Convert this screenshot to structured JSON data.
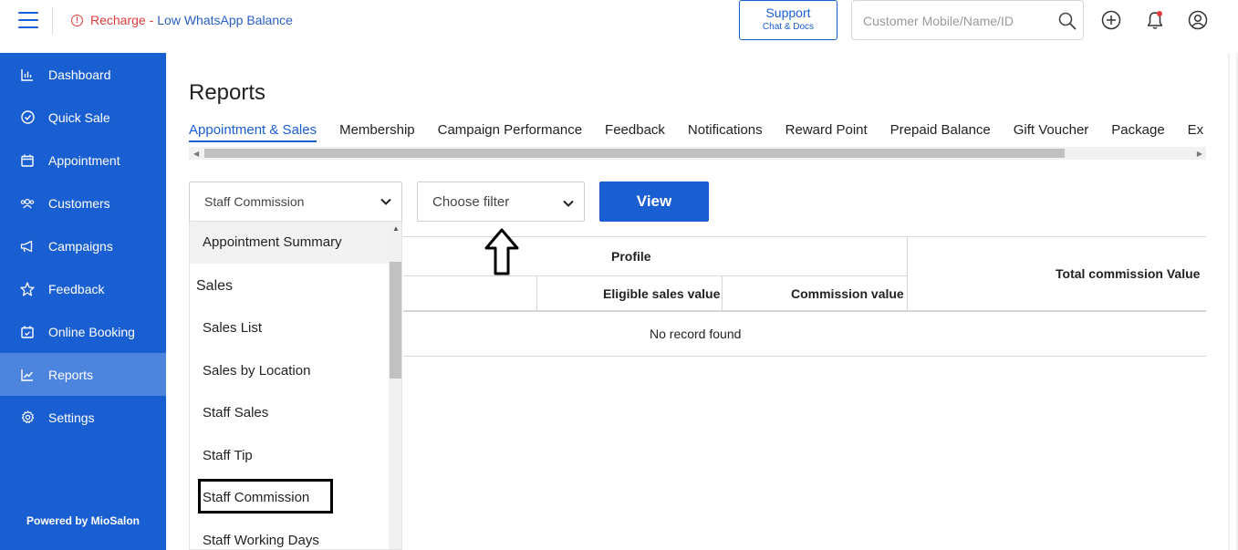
{
  "topbar": {
    "alert_prefix": "Recharge -",
    "alert_text": "Low WhatsApp Balance",
    "support_label": "Support",
    "support_sublabel": "Chat & Docs",
    "search_placeholder": "Customer Mobile/Name/ID"
  },
  "sidebar": {
    "items": [
      {
        "label": "Dashboard",
        "icon": "bar-chart-icon"
      },
      {
        "label": "Quick Sale",
        "icon": "check-circle-icon"
      },
      {
        "label": "Appointment",
        "icon": "calendar-icon"
      },
      {
        "label": "Customers",
        "icon": "users-icon"
      },
      {
        "label": "Campaigns",
        "icon": "megaphone-icon"
      },
      {
        "label": "Feedback",
        "icon": "star-icon"
      },
      {
        "label": "Online Booking",
        "icon": "calendar-check-icon"
      },
      {
        "label": "Reports",
        "icon": "line-chart-icon",
        "active": true
      },
      {
        "label": "Settings",
        "icon": "gear-icon"
      }
    ],
    "powered_by": "Powered by MioSalon"
  },
  "main": {
    "title": "Reports",
    "tabs": [
      "Appointment & Sales",
      "Membership",
      "Campaign Performance",
      "Feedback",
      "Notifications",
      "Reward Point",
      "Prepaid Balance",
      "Gift Voucher",
      "Package",
      "Ex"
    ],
    "active_tab": "Appointment & Sales",
    "report_select_value": "Staff Commission",
    "filter_select_value": "Choose filter",
    "view_label": "View",
    "table": {
      "profile_header": "Profile",
      "eligible_header": "Eligible sales value",
      "commission_header": "Commission value",
      "total_header": "Total commission Value",
      "empty_text": "No record found"
    }
  },
  "dropdown": {
    "first_option": "Appointment Summary",
    "group_label": "Sales",
    "options": [
      "Sales List",
      "Sales by Location",
      "Staff Sales",
      "Staff Tip",
      "Staff Commission",
      "Staff Working Days"
    ],
    "highlighted": "Staff Commission"
  },
  "colors": {
    "primary": "#1a5fd1",
    "sidebar_active": "#4d84de",
    "alert": "#e23b3b"
  }
}
